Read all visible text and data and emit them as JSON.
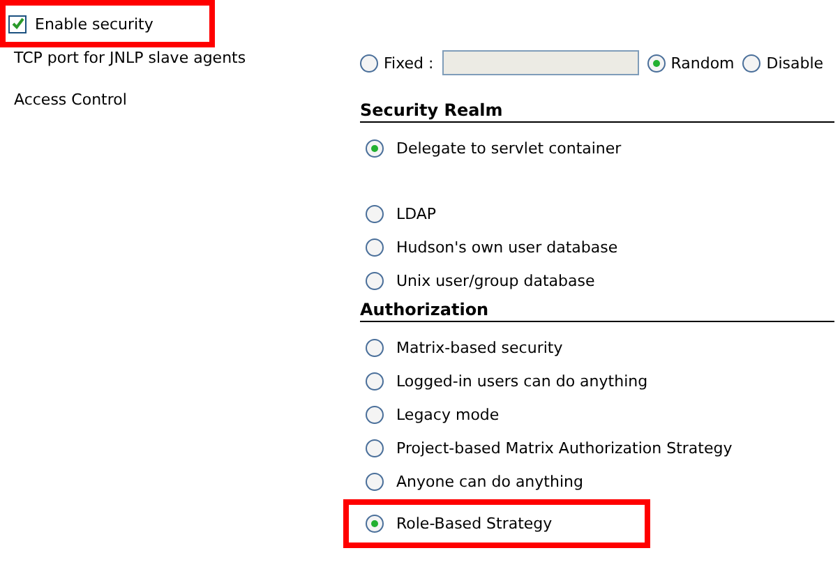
{
  "enable_security": {
    "label": "Enable security",
    "checked": true,
    "highlighted": true
  },
  "tcp_port": {
    "label": "TCP port for JNLP slave agents",
    "options": [
      {
        "label": "Fixed :",
        "selected": false,
        "kind": "field"
      },
      {
        "label": "Random",
        "selected": true,
        "kind": "plain"
      },
      {
        "label": "Disable",
        "selected": false,
        "kind": "plain"
      }
    ]
  },
  "access_control": {
    "label": "Access Control",
    "sections": [
      {
        "title": "Security Realm",
        "options": [
          {
            "label": "Delegate to servlet container",
            "selected": true,
            "highlighted": false
          },
          {
            "label": "LDAP",
            "selected": false,
            "highlighted": false
          },
          {
            "label": "Hudson's own user database",
            "selected": false,
            "highlighted": false
          },
          {
            "label": "Unix user/group database",
            "selected": false,
            "highlighted": false
          }
        ]
      },
      {
        "title": "Authorization",
        "options": [
          {
            "label": "Matrix-based security",
            "selected": false,
            "highlighted": false
          },
          {
            "label": "Logged-in users can do anything",
            "selected": false,
            "highlighted": false
          },
          {
            "label": "Legacy mode",
            "selected": false,
            "highlighted": false
          },
          {
            "label": "Project-based Matrix Authorization Strategy",
            "selected": false,
            "highlighted": false
          },
          {
            "label": "Anyone can do anything",
            "selected": false,
            "highlighted": false
          },
          {
            "label": "Role-Based Strategy",
            "selected": true,
            "highlighted": true
          }
        ]
      }
    ]
  }
}
